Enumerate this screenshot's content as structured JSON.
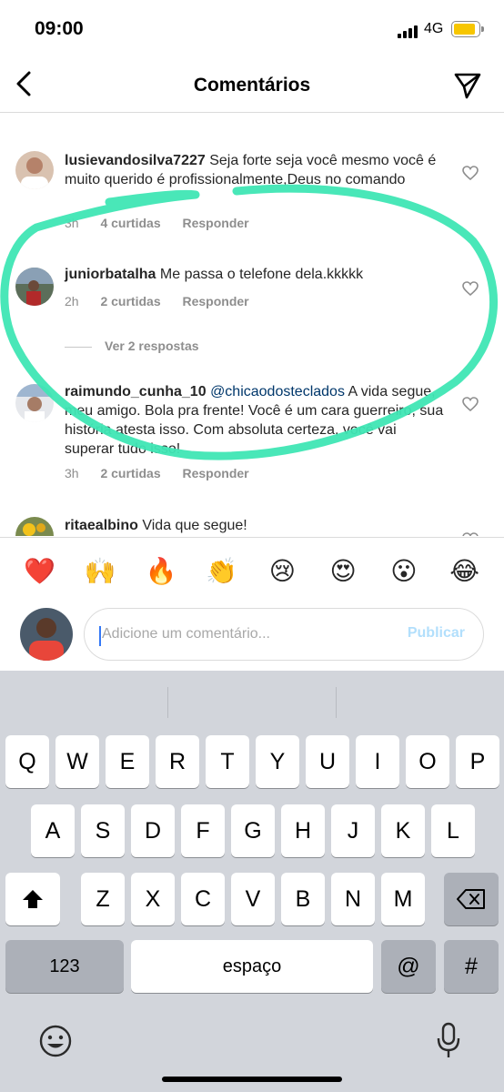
{
  "status": {
    "time": "09:00",
    "network": "4G"
  },
  "header": {
    "title": "Comentários"
  },
  "comments": [
    {
      "username": "lusievandosilva7227",
      "text": "Seja forte seja você  mesmo você  é  muito querido é profissionalmente,Deus no comando",
      "time": "3h",
      "likes": "4 curtidas",
      "reply": "Responder"
    },
    {
      "username": "juniorbatalha",
      "text": "Me passa o telefone dela.kkkkk",
      "time": "2h",
      "likes": "2 curtidas",
      "reply": "Responder",
      "view_replies": "Ver 2 respostas"
    },
    {
      "username": "raimundo_cunha_10",
      "mention": "@chicaodosteclados",
      "text": "A vida segue, meu amigo. Bola pra frente! Você é um cara guerreiro, sua história atesta isso. Com absoluta certeza, você vai superar tudo isso!",
      "time": "3h",
      "likes": "2 curtidas",
      "reply": "Responder"
    },
    {
      "username": "ritaealbino",
      "text": "Vida que segue!"
    }
  ],
  "emojis": [
    "❤️",
    "🙌",
    "🔥",
    "👏",
    "😢",
    "😍",
    "😮",
    "😂"
  ],
  "composer": {
    "placeholder": "Adicione um comentário...",
    "publish": "Publicar"
  },
  "keyboard": {
    "row1": [
      "Q",
      "W",
      "E",
      "R",
      "T",
      "Y",
      "U",
      "I",
      "O",
      "P"
    ],
    "row2": [
      "A",
      "S",
      "D",
      "F",
      "G",
      "H",
      "J",
      "K",
      "L"
    ],
    "row3": [
      "Z",
      "X",
      "C",
      "V",
      "B",
      "N",
      "M"
    ],
    "numbers": "123",
    "space": "espaço",
    "at": "@",
    "hash": "#"
  },
  "colors": {
    "annotation": "#3fe6b4",
    "link": "#00376b",
    "publish": "#b2dffc",
    "keyboard_bg": "#d2d5db"
  }
}
